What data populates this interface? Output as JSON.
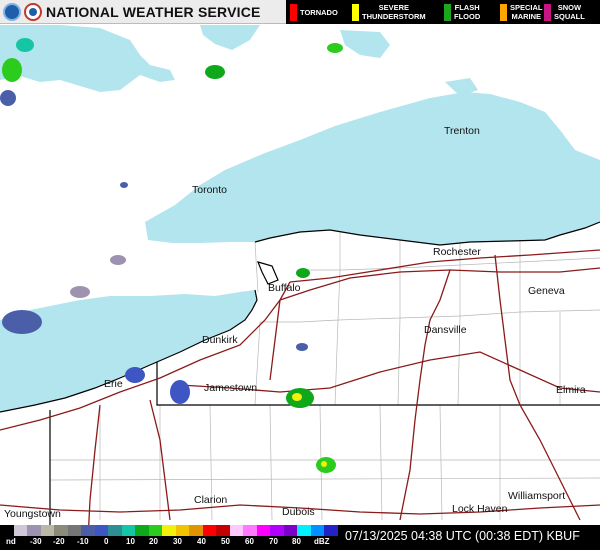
{
  "header": {
    "title": "NATIONAL WEATHER SERVICE",
    "noaa_logo": "noaa-logo-icon",
    "nws_logo": "nws-logo-icon"
  },
  "warnings": [
    {
      "label": "TORNADO",
      "color": "#ff0000"
    },
    {
      "label": "SEVERE\nTHUNDERSTORM",
      "color": "#ffff00"
    },
    {
      "label": "FLASH\nFLOOD",
      "color": "#1ea51e"
    },
    {
      "label": "SPECIAL\nMARINE",
      "color": "#ffa500"
    },
    {
      "label": "SNOW\nSQUALL",
      "color": "#c71585"
    }
  ],
  "cities": {
    "trenton": "Trenton",
    "toronto": "Toronto",
    "rochester": "Rochester",
    "geneva": "Geneva",
    "buffalo": "Buffalo",
    "dansville": "Dansville",
    "dunkirk": "Dunkirk",
    "erie": "Erie",
    "jamestown": "Jamestown",
    "elmira": "Elmira",
    "clarion": "Clarion",
    "williamsport": "Williamsport",
    "dubois": "Dubois",
    "lock_haven": "Lock Haven",
    "youngstown": "Youngstown"
  },
  "scale": {
    "ticks": [
      "nd",
      "-30",
      "-20",
      "-10",
      "0",
      "10",
      "20",
      "30",
      "40",
      "50",
      "60",
      "70",
      "80",
      "dBZ"
    ],
    "colors": [
      "#000000",
      "#cfc7d7",
      "#9d92b0",
      "#b9b7a6",
      "#8c8a79",
      "#757575",
      "#4a5fa8",
      "#3e55c4",
      "#2b8f93",
      "#15c6a6",
      "#0fa81b",
      "#2bcc1d",
      "#f3f00b",
      "#f0c400",
      "#e39200",
      "#ff0000",
      "#c40000",
      "#ffc8ff",
      "#ff78ff",
      "#ff00ff",
      "#b000ff",
      "#7b00c8",
      "#00f0ff",
      "#0090ff",
      "#2222c8"
    ]
  },
  "timestamp": "07/13/2025 04:38 UTC (00:38 EDT) KBUF",
  "colors": {
    "water": "#b3e5ee",
    "land": "#ffffff",
    "highway": "#8b1a1a",
    "border": "#000000"
  }
}
